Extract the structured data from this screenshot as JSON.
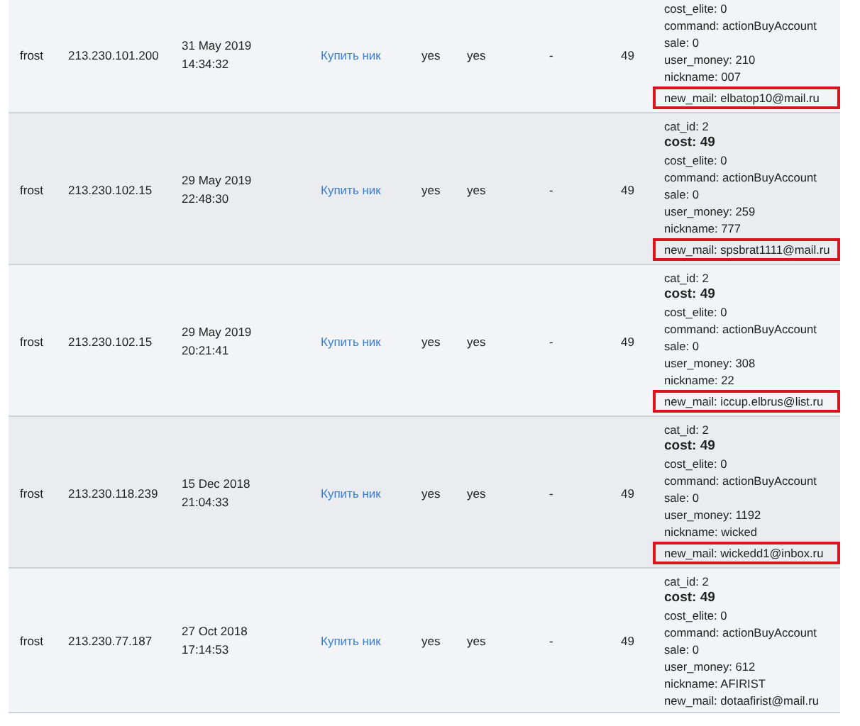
{
  "rows": [
    {
      "user": "frost",
      "ip": "213.230.101.200",
      "date": "31 May 2019",
      "time": "14:34:32",
      "action": "Купить ник",
      "col_5": "yes",
      "col_6": "yes",
      "col_7": "-",
      "col_8": "49",
      "params": [
        {
          "text": "cost_elite: 0",
          "bold": false,
          "highlighted": false
        },
        {
          "text": "command: actionBuyAccount",
          "bold": false,
          "highlighted": false
        },
        {
          "text": "sale: 0",
          "bold": false,
          "highlighted": false
        },
        {
          "text": "user_money: 210",
          "bold": false,
          "highlighted": false
        },
        {
          "text": "nickname: 007",
          "bold": false,
          "highlighted": false
        },
        {
          "text": "new_mail: elbatop10@mail.ru",
          "bold": false,
          "highlighted": true
        }
      ]
    },
    {
      "user": "frost",
      "ip": "213.230.102.15",
      "date": "29 May 2019",
      "time": "22:48:30",
      "action": "Купить ник",
      "col_5": "yes",
      "col_6": "yes",
      "col_7": "-",
      "col_8": "49",
      "params": [
        {
          "text": "cat_id: 2",
          "bold": false,
          "highlighted": false
        },
        {
          "text": "cost: 49",
          "bold": true,
          "highlighted": false
        },
        {
          "text": "cost_elite: 0",
          "bold": false,
          "highlighted": false
        },
        {
          "text": "command: actionBuyAccount",
          "bold": false,
          "highlighted": false
        },
        {
          "text": "sale: 0",
          "bold": false,
          "highlighted": false
        },
        {
          "text": "user_money: 259",
          "bold": false,
          "highlighted": false
        },
        {
          "text": "nickname: 777",
          "bold": false,
          "highlighted": false
        },
        {
          "text": "new_mail: spsbrat1111@mail.ru",
          "bold": false,
          "highlighted": true
        }
      ]
    },
    {
      "user": "frost",
      "ip": "213.230.102.15",
      "date": "29 May 2019",
      "time": "20:21:41",
      "action": "Купить ник",
      "col_5": "yes",
      "col_6": "yes",
      "col_7": "-",
      "col_8": "49",
      "params": [
        {
          "text": "cat_id: 2",
          "bold": false,
          "highlighted": false
        },
        {
          "text": "cost: 49",
          "bold": true,
          "highlighted": false
        },
        {
          "text": "cost_elite: 0",
          "bold": false,
          "highlighted": false
        },
        {
          "text": "command: actionBuyAccount",
          "bold": false,
          "highlighted": false
        },
        {
          "text": "sale: 0",
          "bold": false,
          "highlighted": false
        },
        {
          "text": "user_money: 308",
          "bold": false,
          "highlighted": false
        },
        {
          "text": "nickname: 22",
          "bold": false,
          "highlighted": false
        },
        {
          "text": "new_mail: iccup.elbrus@list.ru",
          "bold": false,
          "highlighted": true
        }
      ]
    },
    {
      "user": "frost",
      "ip": "213.230.118.239",
      "date": "15 Dec 2018",
      "time": "21:04:33",
      "action": "Купить ник",
      "col_5": "yes",
      "col_6": "yes",
      "col_7": "-",
      "col_8": "49",
      "params": [
        {
          "text": "cat_id: 2",
          "bold": false,
          "highlighted": false
        },
        {
          "text": "cost: 49",
          "bold": true,
          "highlighted": false
        },
        {
          "text": "cost_elite: 0",
          "bold": false,
          "highlighted": false
        },
        {
          "text": "command: actionBuyAccount",
          "bold": false,
          "highlighted": false
        },
        {
          "text": "sale: 0",
          "bold": false,
          "highlighted": false
        },
        {
          "text": "user_money: 1192",
          "bold": false,
          "highlighted": false
        },
        {
          "text": "nickname: wicked",
          "bold": false,
          "highlighted": false
        },
        {
          "text": "new_mail: wickedd1@inbox.ru",
          "bold": false,
          "highlighted": true
        }
      ]
    },
    {
      "user": "frost",
      "ip": "213.230.77.187",
      "date": "27 Oct 2018",
      "time": "17:14:53",
      "action": "Купить ник",
      "col_5": "yes",
      "col_6": "yes",
      "col_7": "-",
      "col_8": "49",
      "params": [
        {
          "text": "cat_id: 2",
          "bold": false,
          "highlighted": false
        },
        {
          "text": "cost: 49",
          "bold": true,
          "highlighted": false
        },
        {
          "text": "cost_elite: 0",
          "bold": false,
          "highlighted": false
        },
        {
          "text": "command: actionBuyAccount",
          "bold": false,
          "highlighted": false
        },
        {
          "text": "sale: 0",
          "bold": false,
          "highlighted": false
        },
        {
          "text": "user_money: 612",
          "bold": false,
          "highlighted": false
        },
        {
          "text": "nickname: AFIRIST",
          "bold": false,
          "highlighted": false
        },
        {
          "text": "new_mail: dotaafirist@mail.ru",
          "bold": false,
          "highlighted": false
        }
      ]
    }
  ]
}
